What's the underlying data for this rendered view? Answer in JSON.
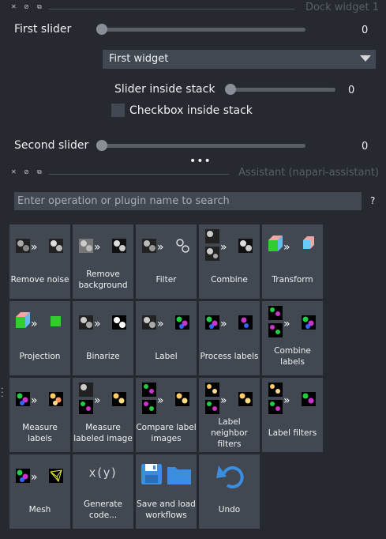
{
  "dock1": {
    "title": "Dock widget 1"
  },
  "first_slider": {
    "label": "First slider",
    "value": "0",
    "fraction": 0
  },
  "combo": {
    "selected": "First widget"
  },
  "stack_slider": {
    "label": "Slider inside stack",
    "value": "0",
    "fraction": 0
  },
  "checkbox": {
    "label": "Checkbox inside stack",
    "checked": false
  },
  "second_slider": {
    "label": "Second slider",
    "value": "0",
    "fraction": 0
  },
  "splitter": {
    "glyph": "•••"
  },
  "dock2": {
    "title": "Assistant (napari-assistant)"
  },
  "search": {
    "placeholder": "Enter operation or plugin name to search",
    "help": "?"
  },
  "tiles": [
    {
      "label": "Remove noise",
      "icon": "remove-noise-icon"
    },
    {
      "label": "Remove background",
      "icon": "remove-background-icon"
    },
    {
      "label": "Filter",
      "icon": "filter-icon"
    },
    {
      "label": "Combine",
      "icon": "combine-icon"
    },
    {
      "label": "Transform",
      "icon": "transform-icon"
    },
    {
      "label": "Projection",
      "icon": "projection-icon"
    },
    {
      "label": "Binarize",
      "icon": "binarize-icon"
    },
    {
      "label": "Label",
      "icon": "label-icon"
    },
    {
      "label": "Process labels",
      "icon": "process-labels-icon"
    },
    {
      "label": "Combine labels",
      "icon": "combine-labels-icon"
    },
    {
      "label": "Measure labels",
      "icon": "measure-labels-icon"
    },
    {
      "label": "Measure labeled image",
      "icon": "measure-labeled-image-icon"
    },
    {
      "label": "Compare label images",
      "icon": "compare-label-images-icon"
    },
    {
      "label": "Label neighbor filters",
      "icon": "label-neighbor-filters-icon"
    },
    {
      "label": "Label filters",
      "icon": "label-filters-icon"
    },
    {
      "label": "Mesh",
      "icon": "mesh-icon"
    },
    {
      "label": "Generate code...",
      "icon": "generate-code-icon"
    },
    {
      "label": "Save and load workflows",
      "icon": "save-load-icon"
    },
    {
      "label": "Undo",
      "icon": "undo-icon"
    }
  ],
  "glyphs": {
    "code": "x(y)"
  }
}
